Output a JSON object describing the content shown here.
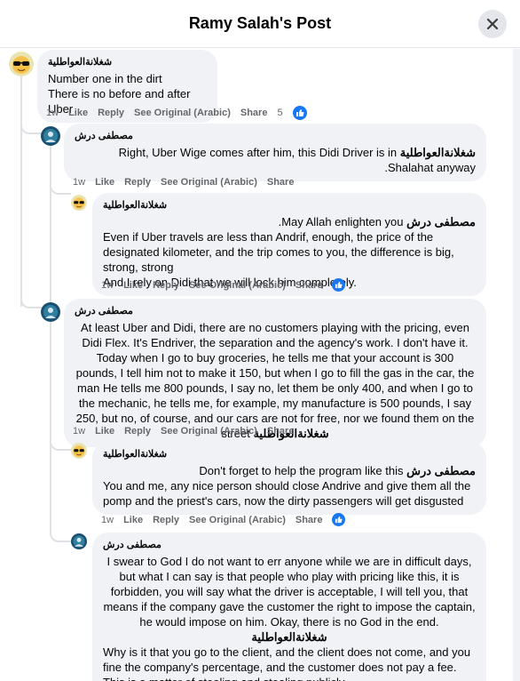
{
  "header": {
    "title": "Ramy Salah's Post"
  },
  "actions_labels": {
    "like": "Like",
    "reply": "Reply",
    "see_original": "See Original (Arabic)",
    "share": "Share"
  },
  "comments": [
    {
      "author": "شغلانةالعواطلية",
      "lines": [
        "Number one in the dirt",
        "There is no before and after Uber"
      ],
      "time": "1w",
      "reactions": "5"
    },
    {
      "author": "مصطفى درش",
      "mention": "شغلانةالعواطلية",
      "text": "Right, Uber Wige comes after him, this Didi Driver is in Shalahat anyway.",
      "time": "1w"
    },
    {
      "author": "شغلانةالعواطلية",
      "mention": "مصطفى درش",
      "text_first": "May Allah enlighten you.",
      "lines": [
        "Even if Uber travels are less than Andrif, enough, the price of the designated kilometer, and the trip comes to you, the difference is big, strong, strong",
        "And I rely on Didi that we will lock him completely."
      ],
      "time": "1w"
    },
    {
      "author": "مصطفى درش",
      "mention": "شغلانةالعواطلية",
      "text": "At least Uber and Didi, there are no customers playing with the pricing, even Didi Flex. It's Endriver, the separation and the agency's work. I don't have it. Today when I go to buy groceries, he tells me that your account is 300 pounds, I tell him not to make it 150, but when I go to fill the gas in the car, the man He tells me 800 pounds, I say no, let them be only 400, and when I go to the mechanic, he tells me, for example, my manufacture is 500 pounds, I say 250, but no, of course, and our cars are not for free, nor we found them on the street",
      "time": "1w"
    },
    {
      "author": "شغلانةالعواطلية",
      "mention": "مصطفى درش",
      "text_first": "Don't forget to help the program like this",
      "lines": [
        "You and me, any nice person should close Andrive and give them all the pomp and the priest's cars, now the dirty passengers will get disgusted"
      ],
      "time": "1w"
    },
    {
      "author": "مصطفى درش",
      "mention": "شغلانةالعواطلية",
      "text": "I swear to God I do not want to err anyone while we are in difficult days, but what I can say is that people who play with pricing like this, it is forbidden, you will say what the driver is acceptable, I will tell you, that means if the company gave the customer the right to impose the captain, he would impose on him. Okay, there is no God in the end.",
      "lines": [
        "Why is it that you go to the client, and the client does not come, and you fine the company's percentage, and the customer does not pay a fee. This is a matter of stealing and stealing publicly."
      ]
    }
  ],
  "icons": {
    "close": "close-icon",
    "like": "like-reaction-icon",
    "avatar_sunglasses": "sunglasses-avatar",
    "avatar_profile": "profile-avatar"
  },
  "colors": {
    "like_blue": "#1877f2",
    "bubble": "#f0f2f5",
    "meta": "#65676b"
  }
}
